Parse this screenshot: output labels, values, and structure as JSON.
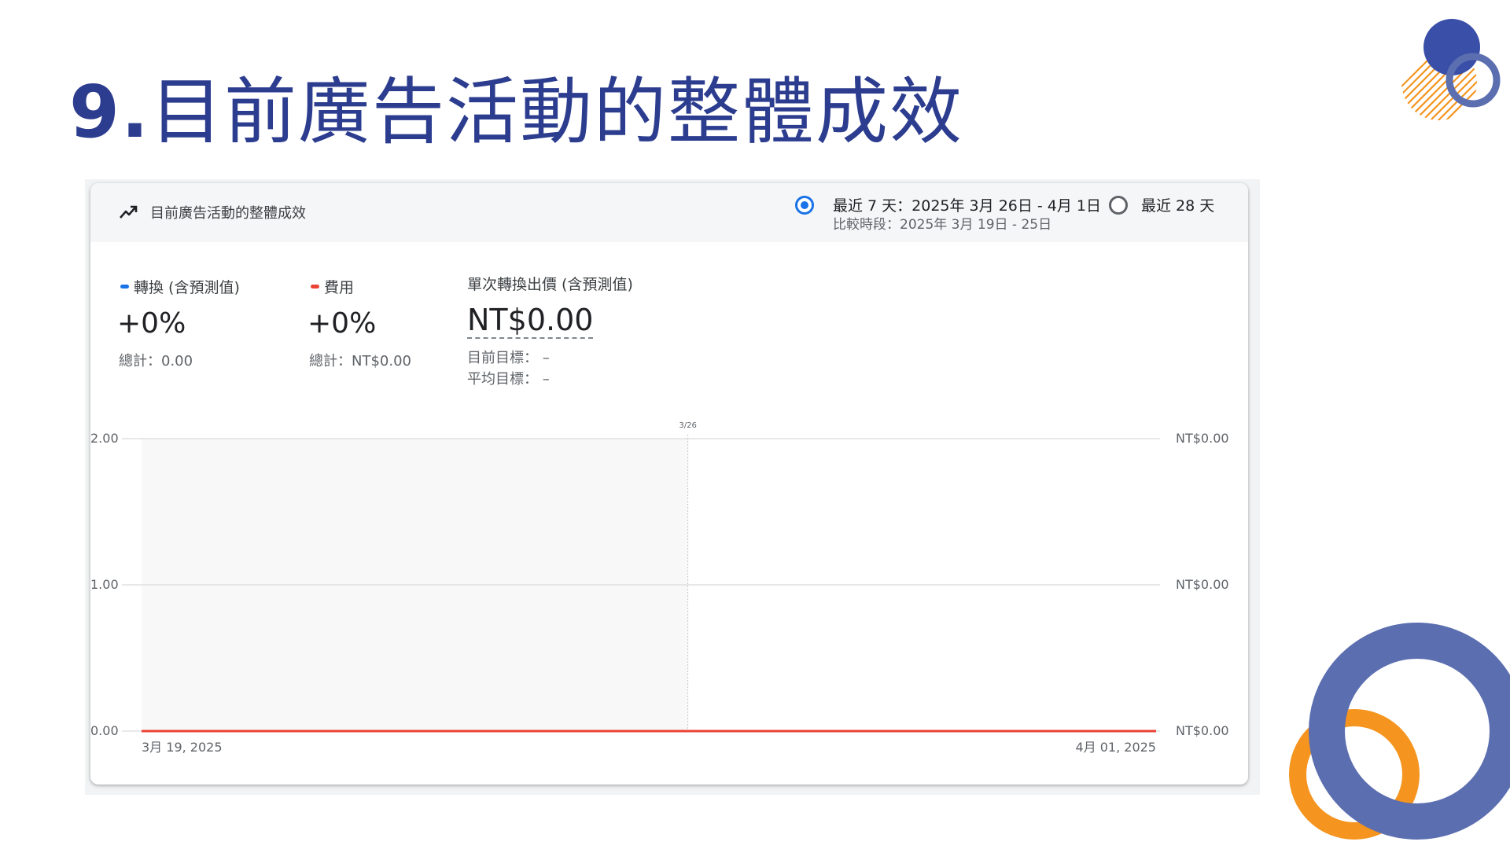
{
  "slide": {
    "number": "9.",
    "title": "目前廣告活動的整體成效"
  },
  "colors": {
    "title": "#2c3d8f",
    "conversions_series": "#1a73e8",
    "cost_series": "#ea4335",
    "deco_blue": "#5b6eb0",
    "deco_orange": "#f5941e"
  },
  "card": {
    "title": "目前廣告活動的整體成效",
    "icon": "trending-up-icon",
    "date_range": {
      "option_7_label": "最近 7 天：2025年 3月 26日 - 4月 1日",
      "option_7_compare": "比較時段：2025年 3月 19日 - 25日",
      "option_7_selected": true,
      "option_28_label": "最近 28 天",
      "option_28_selected": false
    },
    "metrics": {
      "conversions": {
        "name": "轉換 (含預測值)",
        "change": "+0%",
        "total": "總計：0.00"
      },
      "cost": {
        "name": "費用",
        "change": "+0%",
        "total": "總計：NT$0.00"
      },
      "cost_per_conversion": {
        "name": "單次轉換出價 (含預測值)",
        "value": "NT$0.00",
        "current_target": "目前目標：  –",
        "average_target": "平均目標：  –"
      }
    }
  },
  "chart_data": {
    "type": "line",
    "x": [
      "2025-03-19",
      "2025-03-20",
      "2025-03-21",
      "2025-03-22",
      "2025-03-23",
      "2025-03-24",
      "2025-03-25",
      "2025-03-26",
      "2025-03-27",
      "2025-03-28",
      "2025-03-29",
      "2025-03-30",
      "2025-03-31",
      "2025-04-01"
    ],
    "x_tick_labels": [
      "3月 19, 2025",
      "4月 01, 2025"
    ],
    "divider_label": "3/26",
    "left_axis": {
      "ticks": [
        "2.00",
        "1.00",
        "0.00"
      ],
      "ylim": [
        0,
        2
      ]
    },
    "right_axis": {
      "ticks": [
        "NT$0.00",
        "NT$0.00",
        "NT$0.00"
      ]
    },
    "series": [
      {
        "name": "轉換 (含預測值)",
        "axis": "left",
        "values": [
          0,
          0,
          0,
          0,
          0,
          0,
          0,
          0,
          0,
          0,
          0,
          0,
          0,
          0
        ]
      },
      {
        "name": "費用",
        "axis": "right",
        "values": [
          0,
          0,
          0,
          0,
          0,
          0,
          0,
          0,
          0,
          0,
          0,
          0,
          0,
          0
        ]
      }
    ],
    "comparison_period_shaded": true,
    "grid": true
  }
}
